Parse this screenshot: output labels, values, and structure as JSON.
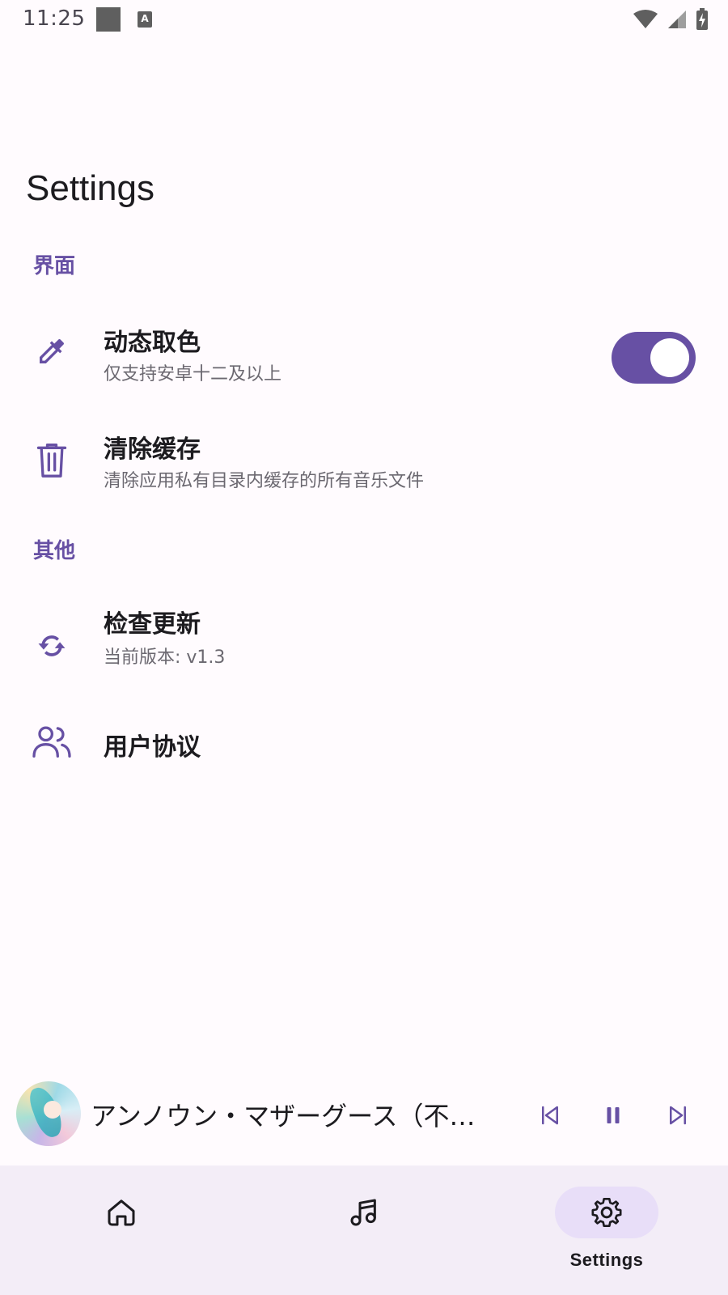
{
  "status_bar": {
    "time": "11:25",
    "notif_badge": "A",
    "icons": [
      "wifi-icon",
      "signal-icon",
      "battery-charging-icon"
    ]
  },
  "page": {
    "title": "Settings"
  },
  "sections": {
    "interface": {
      "header": "界面",
      "dynamic_color": {
        "title": "动态取色",
        "subtitle": "仅支持安卓十二及以上",
        "icon": "eyedropper-icon",
        "enabled": true
      },
      "clear_cache": {
        "title": "清除缓存",
        "subtitle": "清除应用私有目录内缓存的所有音乐文件",
        "icon": "trash-icon"
      }
    },
    "other": {
      "header": "其他",
      "check_update": {
        "title": "检查更新",
        "subtitle": "当前版本: v1.3",
        "icon": "refresh-icon"
      },
      "user_agreement": {
        "title": "用户协议",
        "icon": "users-icon"
      }
    }
  },
  "player": {
    "track_title": "アンノウン・マザーグース（不为人知的鹅妈妈童谣）",
    "controls": [
      "skip-previous-icon",
      "pause-icon",
      "skip-next-icon"
    ]
  },
  "bottom_nav": {
    "items": [
      {
        "icon": "home-icon",
        "label": ""
      },
      {
        "icon": "music-note-icon",
        "label": ""
      },
      {
        "icon": "gear-icon",
        "label": "Settings",
        "active": true
      }
    ]
  },
  "colors": {
    "accent": "#6750a4",
    "background": "#fffbfe",
    "nav_background": "#f3edf7",
    "nav_active_pill": "#e8def8"
  }
}
